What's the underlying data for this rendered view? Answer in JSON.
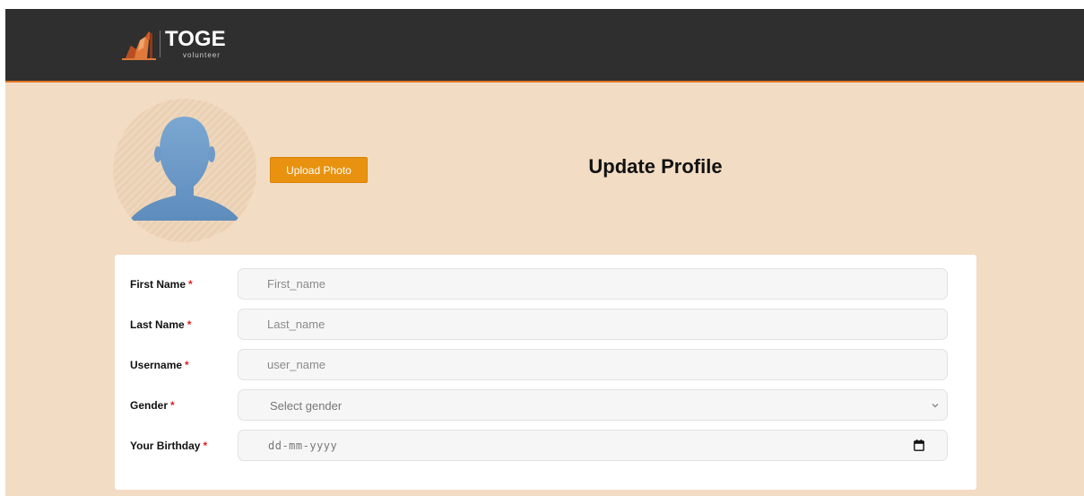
{
  "header": {
    "logo": {
      "title": "TOGE",
      "subtitle": "volunteer"
    }
  },
  "profile": {
    "upload_label": "Upload Photo",
    "title": "Update Profile"
  },
  "form": {
    "required_mark": "*",
    "fields": [
      {
        "label": "First Name",
        "placeholder": "First_name",
        "type": "text"
      },
      {
        "label": "Last Name",
        "placeholder": "Last_name",
        "type": "text"
      },
      {
        "label": "Username",
        "placeholder": "user_name",
        "type": "text"
      },
      {
        "label": "Gender",
        "value": "Select gender",
        "type": "select"
      },
      {
        "label": "Your Birthday",
        "value": "dd-mm-yyyy",
        "type": "date"
      }
    ]
  },
  "colors": {
    "header_bg": "#2f2f2f",
    "accent_line": "#e0772a",
    "page_bg": "#f2dcc3",
    "button_bg": "#e8920f",
    "required": "#e02020",
    "avatar_blue": "#6f9cc9"
  },
  "icons": {
    "logo": "logo-figure-icon",
    "avatar": "user-silhouette-icon",
    "select": "chevron-down-icon",
    "date": "calendar-icon"
  }
}
